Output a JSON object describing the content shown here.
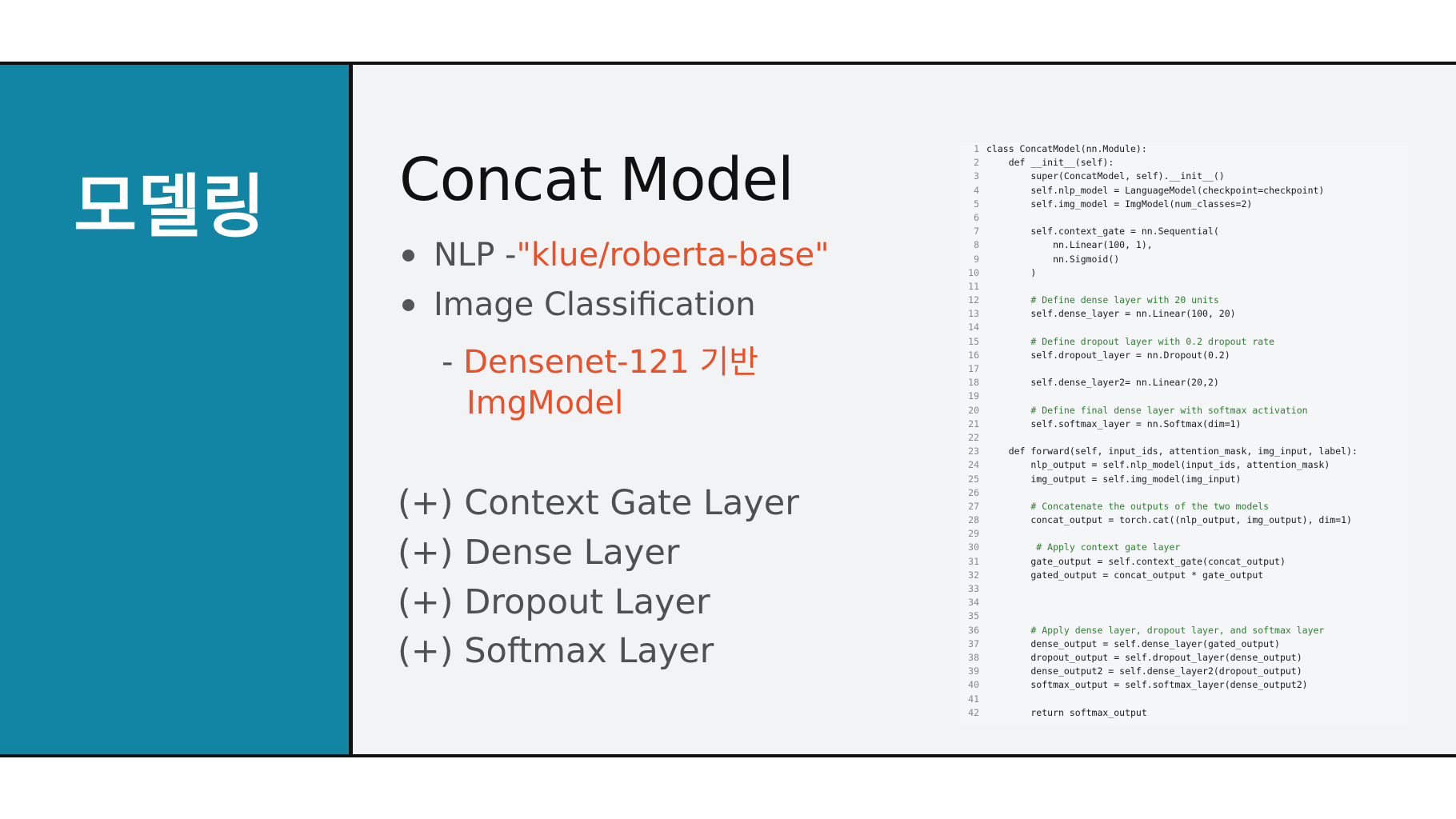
{
  "sidebar": {
    "title": "모델링"
  },
  "main": {
    "title": "Concat Model",
    "bullets": [
      {
        "label": "NLP - ",
        "highlight": "\"klue/roberta-base\""
      },
      {
        "label": "Image Classification",
        "highlight": ""
      }
    ],
    "sub_line1": "- ",
    "sub_highlight1": "Densenet-121 기반",
    "sub_highlight2": "ImgModel",
    "layers": [
      "(+) Context Gate Layer",
      "(+) Dense Layer",
      "(+) Dropout Layer",
      "(+) Softmax Layer"
    ]
  },
  "colors": {
    "sidebar": "#1285a5",
    "accent": "#e8512a",
    "text": "#505050",
    "content_bg": "#f2f3f5"
  },
  "code": {
    "lines": [
      {
        "n": "1",
        "text": "class ConcatModel(nn.Module):"
      },
      {
        "n": "2",
        "text": "    def __init__(self):"
      },
      {
        "n": "3",
        "text": "        super(ConcatModel, self).__init__()"
      },
      {
        "n": "4",
        "text": "        self.nlp_model = LanguageModel(checkpoint=checkpoint)"
      },
      {
        "n": "5",
        "text": "        self.img_model = ImgModel(num_classes=2)"
      },
      {
        "n": "6",
        "text": ""
      },
      {
        "n": "7",
        "text": "        self.context_gate = nn.Sequential("
      },
      {
        "n": "8",
        "text": "            nn.Linear(100, 1),"
      },
      {
        "n": "9",
        "text": "            nn.Sigmoid()"
      },
      {
        "n": "10",
        "text": "        )"
      },
      {
        "n": "11",
        "text": ""
      },
      {
        "n": "12",
        "text": "        # Define dense layer with 20 units"
      },
      {
        "n": "13",
        "text": "        self.dense_layer = nn.Linear(100, 20)"
      },
      {
        "n": "14",
        "text": ""
      },
      {
        "n": "15",
        "text": "        # Define dropout layer with 0.2 dropout rate"
      },
      {
        "n": "16",
        "text": "        self.dropout_layer = nn.Dropout(0.2)"
      },
      {
        "n": "17",
        "text": ""
      },
      {
        "n": "18",
        "text": "        self.dense_layer2= nn.Linear(20,2)"
      },
      {
        "n": "19",
        "text": ""
      },
      {
        "n": "20",
        "text": "        # Define final dense layer with softmax activation"
      },
      {
        "n": "21",
        "text": "        self.softmax_layer = nn.Softmax(dim=1)"
      },
      {
        "n": "22",
        "text": ""
      },
      {
        "n": "23",
        "text": "    def forward(self, input_ids, attention_mask, img_input, label):"
      },
      {
        "n": "24",
        "text": "        nlp_output = self.nlp_model(input_ids, attention_mask)"
      },
      {
        "n": "25",
        "text": "        img_output = self.img_model(img_input)"
      },
      {
        "n": "26",
        "text": ""
      },
      {
        "n": "27",
        "text": "        # Concatenate the outputs of the two models"
      },
      {
        "n": "28",
        "text": "        concat_output = torch.cat((nlp_output, img_output), dim=1)"
      },
      {
        "n": "29",
        "text": ""
      },
      {
        "n": "30",
        "text": "         # Apply context gate layer"
      },
      {
        "n": "31",
        "text": "        gate_output = self.context_gate(concat_output)"
      },
      {
        "n": "32",
        "text": "        gated_output = concat_output * gate_output"
      },
      {
        "n": "33",
        "text": ""
      },
      {
        "n": "34",
        "text": ""
      },
      {
        "n": "35",
        "text": ""
      },
      {
        "n": "36",
        "text": "        # Apply dense layer, dropout layer, and softmax layer"
      },
      {
        "n": "37",
        "text": "        dense_output = self.dense_layer(gated_output)"
      },
      {
        "n": "38",
        "text": "        dropout_output = self.dropout_layer(dense_output)"
      },
      {
        "n": "39",
        "text": "        dense_output2 = self.dense_layer2(dropout_output)"
      },
      {
        "n": "40",
        "text": "        softmax_output = self.softmax_layer(dense_output2)"
      },
      {
        "n": "41",
        "text": ""
      },
      {
        "n": "42",
        "text": "        return softmax_output"
      }
    ]
  }
}
